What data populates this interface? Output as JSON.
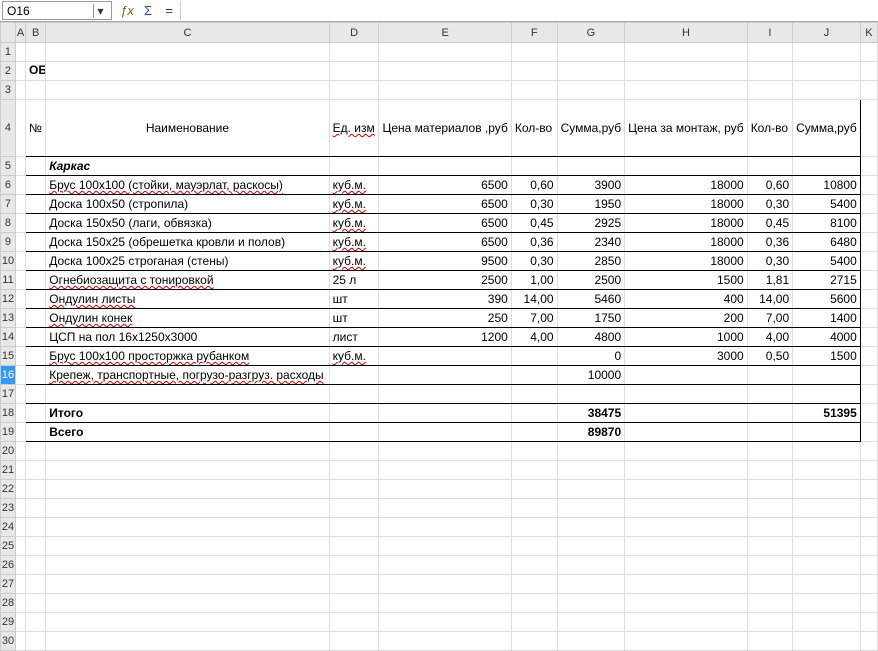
{
  "nameBox": "O16",
  "title": "ОБЪЕКТНЫЙ РАСЧЕТ И СТОИМОСТЬ МАТЕРИАЛОВ И РАБОТ по Беседке",
  "cols": [
    "A",
    "B",
    "C",
    "D",
    "E",
    "F",
    "G",
    "H",
    "I",
    "J",
    "K"
  ],
  "rows": [
    "1",
    "2",
    "3",
    "4",
    "5",
    "6",
    "7",
    "8",
    "9",
    "10",
    "11",
    "12",
    "13",
    "14",
    "15",
    "16",
    "17",
    "18",
    "19",
    "20",
    "21",
    "22",
    "23",
    "24",
    "25",
    "26",
    "27",
    "28",
    "29",
    "30"
  ],
  "hdr": {
    "B": "№",
    "C": "Наименование",
    "D": "Ед. изм",
    "E": "Цена материалов ,руб",
    "F": "Кол-во",
    "G": "Сумма,руб",
    "H": "Цена за монтаж, руб",
    "I": "Кол-во",
    "J": "Сумма,руб"
  },
  "karkas": "Каркас",
  "r6": {
    "c": "Брус 100х100  (стойки, мауэрлат, раскосы)",
    "d": "куб.м.",
    "e": "6500",
    "f": "0,60",
    "g": "3900",
    "h": "18000",
    "i": "0,60",
    "j": "10800"
  },
  "r7": {
    "c": "Доска 100х50  (стропила)",
    "d": "куб.м.",
    "e": "6500",
    "f": "0,30",
    "g": "1950",
    "h": "18000",
    "i": "0,30",
    "j": "5400"
  },
  "r8": {
    "c": "Доска 150х50 (лаги, обвязка)",
    "d": "куб.м.",
    "e": "6500",
    "f": "0,45",
    "g": "2925",
    "h": "18000",
    "i": "0,45",
    "j": "8100"
  },
  "r9": {
    "c": "Доска 150х25 (обрешетка кровли и полов)",
    "d": "куб.м.",
    "e": "6500",
    "f": "0,36",
    "g": "2340",
    "h": "18000",
    "i": "0,36",
    "j": "6480"
  },
  "r10": {
    "c": "Доска 100х25 строганая (стены)",
    "d": "куб.м.",
    "e": "9500",
    "f": "0,30",
    "g": "2850",
    "h": "18000",
    "i": "0,30",
    "j": "5400"
  },
  "r11": {
    "c": "Огнебиозащита с тонировкой",
    "d": "25 л",
    "e": "2500",
    "f": "1,00",
    "g": "2500",
    "h": "1500",
    "i": "1,81",
    "j": "2715"
  },
  "r12": {
    "c": "Ондулин листы",
    "d": "шт",
    "e": "390",
    "f": "14,00",
    "g": "5460",
    "h": "400",
    "i": "14,00",
    "j": "5600"
  },
  "r13": {
    "c": "Ондулин  конек",
    "d": "шт",
    "e": "250",
    "f": "7,00",
    "g": "1750",
    "h": "200",
    "i": "7,00",
    "j": "1400"
  },
  "r14": {
    "c": "ЦСП на пол 16х1250х3000",
    "d": "лист",
    "e": "1200",
    "f": "4,00",
    "g": "4800",
    "h": "1000",
    "i": "4,00",
    "j": "4000"
  },
  "r15": {
    "c": "Брус 100х100 просторжка рубанком",
    "d": "куб.м.",
    "e": "",
    "f": "",
    "g": "0",
    "h": "3000",
    "i": "0,50",
    "j": "1500"
  },
  "r16": {
    "c": "Крепеж, транспортные, погрузо-разгруз. расходы",
    "g": "10000"
  },
  "itogo": {
    "label": "Итого",
    "g": "38475",
    "j": "51395"
  },
  "vsego": {
    "label": "Всего",
    "g": "89870"
  }
}
